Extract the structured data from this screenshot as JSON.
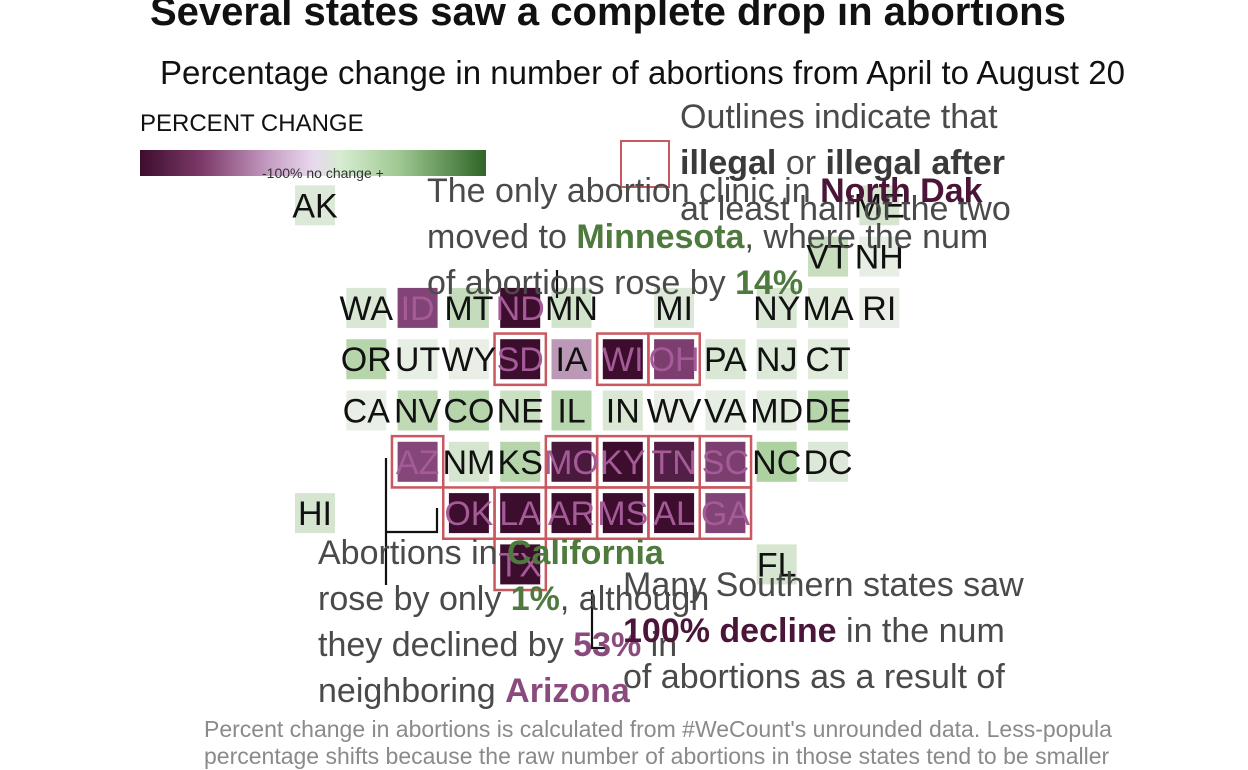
{
  "title": "Several states saw a complete drop in abortions",
  "subtitle": "Percentage change in number of abortions from April to August 20",
  "legend": {
    "title": "PERCENT CHANGE",
    "label": "-100%   no change   +",
    "colors": [
      "#3d0d2e",
      "#7d3a6a",
      "#c8a0c6",
      "#e8d8ee",
      "#d6ecd0",
      "#9fc892",
      "#2f6526"
    ]
  },
  "annotations": {
    "legal": {
      "line1": "Outlines indicate that",
      "line2a": "illegal",
      "line2b": " or ",
      "line2c": "illegal after",
      "line3": "at least half of the two"
    },
    "nd": {
      "line1a": "The only abortion clinic in ",
      "line1b": "North Dak",
      "line2a": "moved to ",
      "line2b": "Minnesota",
      "line2c": ", where the num",
      "line3a": "of abortions rose by ",
      "line3b": "14%"
    },
    "ca": {
      "line1a": "Abortions in ",
      "line1b": "California",
      "line2a": "rose by only ",
      "line2b": "1%",
      "line2c": ", although",
      "line3a": "they declined by ",
      "line3b": "53%",
      "line3c": " in",
      "line4a": "neighboring ",
      "line4b": "Arizona"
    },
    "south": {
      "line1": "Many Southern states saw",
      "line2a": "100% decline",
      "line2b": " in the num",
      "line3": "of abortions as a result of"
    }
  },
  "caption": {
    "line1": "Percent change in abortions is calculated from #WeCount's unrounded data. Less-popula",
    "line2": "percentage shifts because the raw number of abortions in those states tend to be smaller"
  },
  "chart_data": {
    "type": "heatmap",
    "title": "Several states saw a complete drop in abortions",
    "subtitle": "Percentage change in number of abortions from April to August 20",
    "color_scale": {
      "min": -100,
      "mid": 0,
      "max": 100
    },
    "states": [
      {
        "abbr": "AK",
        "row": 1,
        "col": 0,
        "change": 8,
        "outlined": false
      },
      {
        "abbr": "ME",
        "row": 1,
        "col": 11,
        "change": 12,
        "outlined": false
      },
      {
        "abbr": "VT",
        "row": 2,
        "col": 10,
        "change": 20,
        "outlined": false
      },
      {
        "abbr": "NH",
        "row": 2,
        "col": 11,
        "change": 2,
        "outlined": false
      },
      {
        "abbr": "WA",
        "row": 3,
        "col": 1,
        "change": 10,
        "outlined": false
      },
      {
        "abbr": "ID",
        "row": 3,
        "col": 2,
        "change": -55,
        "outlined": false
      },
      {
        "abbr": "MT",
        "row": 3,
        "col": 3,
        "change": 22,
        "outlined": false
      },
      {
        "abbr": "ND",
        "row": 3,
        "col": 4,
        "change": -100,
        "outlined": false
      },
      {
        "abbr": "MN",
        "row": 3,
        "col": 5,
        "change": 14,
        "outlined": false
      },
      {
        "abbr": "MI",
        "row": 3,
        "col": 7,
        "change": 8,
        "outlined": false
      },
      {
        "abbr": "NY",
        "row": 3,
        "col": 9,
        "change": 10,
        "outlined": false
      },
      {
        "abbr": "MA",
        "row": 3,
        "col": 10,
        "change": 6,
        "outlined": false
      },
      {
        "abbr": "RI",
        "row": 3,
        "col": 11,
        "change": 1,
        "outlined": false
      },
      {
        "abbr": "OR",
        "row": 4,
        "col": 1,
        "change": 30,
        "outlined": false
      },
      {
        "abbr": "UT",
        "row": 4,
        "col": 2,
        "change": 2,
        "outlined": false
      },
      {
        "abbr": "WY",
        "row": 4,
        "col": 3,
        "change": 1,
        "outlined": false
      },
      {
        "abbr": "SD",
        "row": 4,
        "col": 4,
        "change": -100,
        "outlined": true
      },
      {
        "abbr": "IA",
        "row": 4,
        "col": 5,
        "change": -25,
        "outlined": false
      },
      {
        "abbr": "WI",
        "row": 4,
        "col": 6,
        "change": -100,
        "outlined": true
      },
      {
        "abbr": "OH",
        "row": 4,
        "col": 7,
        "change": -60,
        "outlined": true
      },
      {
        "abbr": "PA",
        "row": 4,
        "col": 8,
        "change": 10,
        "outlined": false
      },
      {
        "abbr": "NJ",
        "row": 4,
        "col": 9,
        "change": 8,
        "outlined": false
      },
      {
        "abbr": "CT",
        "row": 4,
        "col": 10,
        "change": 6,
        "outlined": false
      },
      {
        "abbr": "CA",
        "row": 5,
        "col": 1,
        "change": 1,
        "outlined": false
      },
      {
        "abbr": "NV",
        "row": 5,
        "col": 2,
        "change": 25,
        "outlined": false
      },
      {
        "abbr": "CO",
        "row": 5,
        "col": 3,
        "change": 30,
        "outlined": false
      },
      {
        "abbr": "NE",
        "row": 5,
        "col": 4,
        "change": 18,
        "outlined": false
      },
      {
        "abbr": "IL",
        "row": 5,
        "col": 5,
        "change": 28,
        "outlined": false
      },
      {
        "abbr": "IN",
        "row": 5,
        "col": 6,
        "change": 10,
        "outlined": false
      },
      {
        "abbr": "WV",
        "row": 5,
        "col": 7,
        "change": 1,
        "outlined": false
      },
      {
        "abbr": "VA",
        "row": 5,
        "col": 8,
        "change": 3,
        "outlined": false
      },
      {
        "abbr": "MD",
        "row": 5,
        "col": 9,
        "change": 5,
        "outlined": false
      },
      {
        "abbr": "DE",
        "row": 5,
        "col": 10,
        "change": 30,
        "outlined": false
      },
      {
        "abbr": "AZ",
        "row": 6,
        "col": 2,
        "change": -53,
        "outlined": true
      },
      {
        "abbr": "NM",
        "row": 6,
        "col": 3,
        "change": 12,
        "outlined": false
      },
      {
        "abbr": "KS",
        "row": 6,
        "col": 4,
        "change": 30,
        "outlined": false
      },
      {
        "abbr": "MO",
        "row": 6,
        "col": 5,
        "change": -90,
        "outlined": true
      },
      {
        "abbr": "KY",
        "row": 6,
        "col": 6,
        "change": -100,
        "outlined": true
      },
      {
        "abbr": "TN",
        "row": 6,
        "col": 7,
        "change": -85,
        "outlined": true
      },
      {
        "abbr": "SC",
        "row": 6,
        "col": 8,
        "change": -60,
        "outlined": true
      },
      {
        "abbr": "NC",
        "row": 6,
        "col": 9,
        "change": 35,
        "outlined": false
      },
      {
        "abbr": "DC",
        "row": 6,
        "col": 10,
        "change": 8,
        "outlined": false
      },
      {
        "abbr": "HI",
        "row": 7,
        "col": 0,
        "change": 12,
        "outlined": false
      },
      {
        "abbr": "OK",
        "row": 7,
        "col": 3,
        "change": -100,
        "outlined": true
      },
      {
        "abbr": "LA",
        "row": 7,
        "col": 4,
        "change": -100,
        "outlined": true
      },
      {
        "abbr": "AR",
        "row": 7,
        "col": 5,
        "change": -100,
        "outlined": true
      },
      {
        "abbr": "MS",
        "row": 7,
        "col": 6,
        "change": -100,
        "outlined": true
      },
      {
        "abbr": "AL",
        "row": 7,
        "col": 7,
        "change": -100,
        "outlined": true
      },
      {
        "abbr": "GA",
        "row": 7,
        "col": 8,
        "change": -55,
        "outlined": true
      },
      {
        "abbr": "TX",
        "row": 8,
        "col": 4,
        "change": -100,
        "outlined": true
      },
      {
        "abbr": "FL",
        "row": 8,
        "col": 9,
        "change": 12,
        "outlined": false
      }
    ]
  }
}
